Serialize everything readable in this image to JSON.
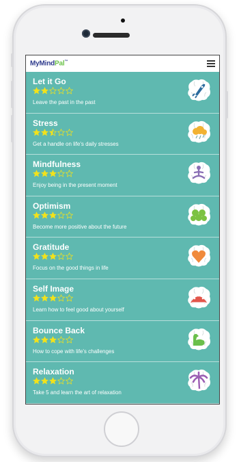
{
  "app": {
    "logo_my": "My",
    "logo_mind": "Mind",
    "logo_pal": "Pal",
    "logo_tm": "™"
  },
  "colors": {
    "screen_bg": "#5fb9b0",
    "star_fill": "#f2e21b",
    "logo_blue": "#2e3a8c",
    "logo_green": "#6cc24a"
  },
  "items": [
    {
      "title": "Let it Go",
      "desc": "Leave the past in the past",
      "rating": 2,
      "icon": "rocket-icon",
      "icon_color": "#2c6b9e"
    },
    {
      "title": "Stress",
      "desc": "Get a handle on life's daily stresses",
      "rating": 2.5,
      "icon": "storm-cloud-icon",
      "icon_color": "#f2b233"
    },
    {
      "title": "Mindfulness",
      "desc": "Enjoy being in the present moment",
      "rating": 3,
      "icon": "meditation-icon",
      "icon_color": "#8a6fb5"
    },
    {
      "title": "Optimism",
      "desc": "Become more positive about the future",
      "rating": 3,
      "icon": "clover-icon",
      "icon_color": "#7cc242"
    },
    {
      "title": "Gratitude",
      "desc": "Focus on the good things in life",
      "rating": 3,
      "icon": "heart-icon",
      "icon_color": "#f08a3c"
    },
    {
      "title": "Self Image",
      "desc": "Learn how to feel good about yourself",
      "rating": 3,
      "icon": "crown-icon",
      "icon_color": "#e2574c"
    },
    {
      "title": "Bounce Back",
      "desc": "How to cope with life's challenges",
      "rating": 3,
      "icon": "muscle-arm-icon",
      "icon_color": "#6abf4b"
    },
    {
      "title": "Relaxation",
      "desc": "Take 5 and learn the art of relaxation",
      "rating": 3,
      "icon": "palm-tree-icon",
      "icon_color": "#9b5fb3"
    }
  ]
}
